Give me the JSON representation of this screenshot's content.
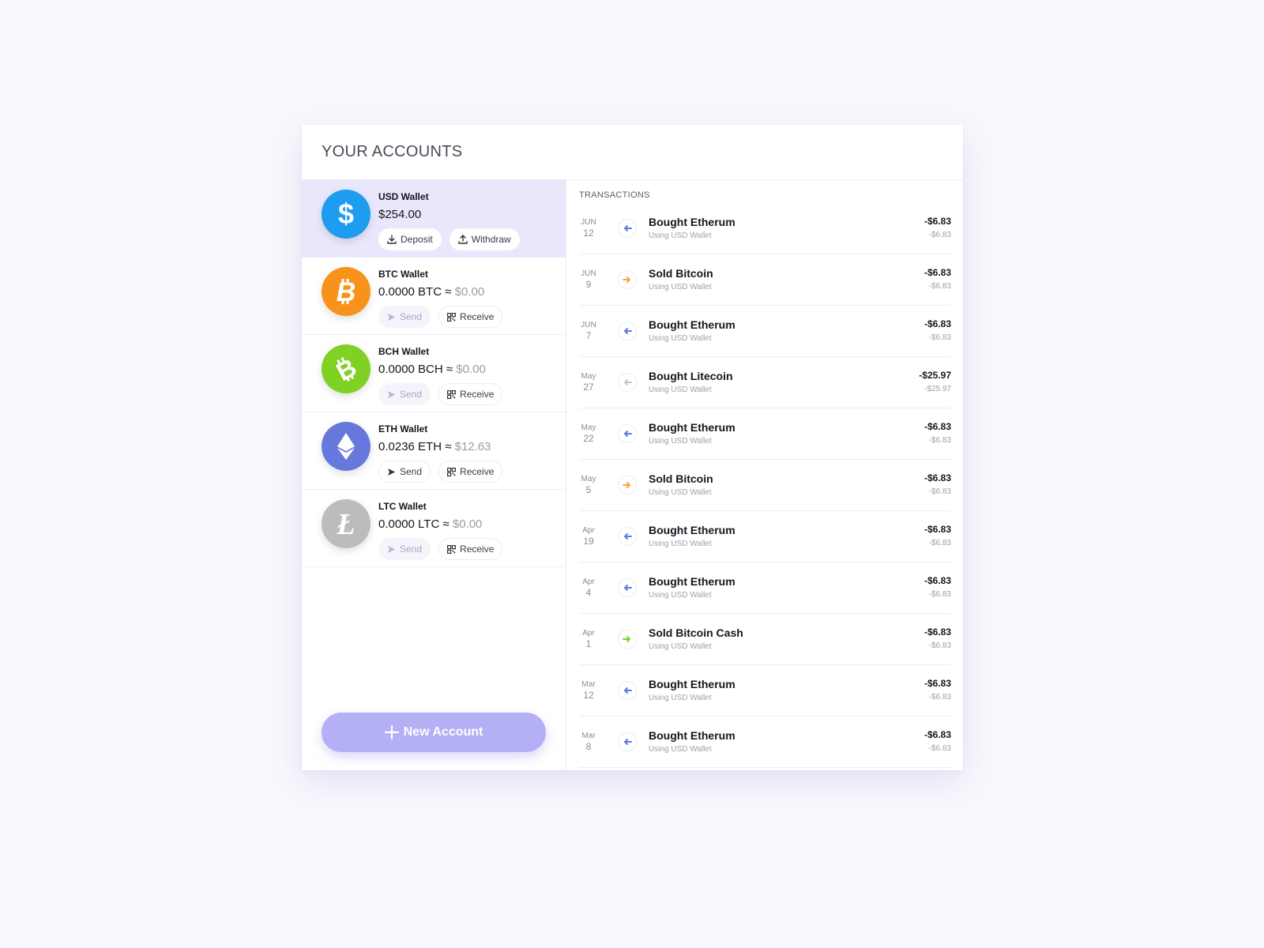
{
  "header": {
    "title": "YOUR ACCOUNTS"
  },
  "colors": {
    "accent": "#b4b0f5",
    "active_row": "#e8e7fb",
    "usd": "#1e9cf0",
    "btc": "#f7931a",
    "bch": "#7fd124",
    "eth": "#6778dc",
    "ltc": "#bcbcbc",
    "arrow_eth": "#6778dc",
    "arrow_btc": "#f7a83a",
    "arrow_bch": "#7fd124",
    "arrow_ltc": "#c4c4cc"
  },
  "accounts": [
    {
      "name": "USD Wallet",
      "balance": "$254.00",
      "approx": "",
      "fiat": "",
      "icon": "dollar-icon",
      "actions": [
        {
          "label": "Deposit",
          "icon": "download-icon"
        },
        {
          "label": "Withdraw",
          "icon": "upload-icon"
        }
      ]
    },
    {
      "name": "BTC Wallet",
      "balance": "0.0000 BTC",
      "approx": " ≈ ",
      "fiat": "$0.00",
      "icon": "bitcoin-icon",
      "actions": [
        {
          "label": "Send",
          "icon": "send-icon"
        },
        {
          "label": "Receive",
          "icon": "qr-code-icon"
        }
      ]
    },
    {
      "name": "BCH Wallet",
      "balance": "0.0000 BCH",
      "approx": " ≈ ",
      "fiat": "$0.00",
      "icon": "bitcoin-cash-icon",
      "actions": [
        {
          "label": "Send",
          "icon": "send-icon"
        },
        {
          "label": "Receive",
          "icon": "qr-code-icon"
        }
      ]
    },
    {
      "name": "ETH Wallet",
      "balance": "0.0236 ETH",
      "approx": " ≈ ",
      "fiat": "$12.63",
      "icon": "ethereum-icon",
      "actions": [
        {
          "label": "Send",
          "icon": "send-icon"
        },
        {
          "label": "Receive",
          "icon": "qr-code-icon"
        }
      ]
    },
    {
      "name": "LTC Wallet",
      "balance": "0.0000 LTC",
      "approx": " ≈ ",
      "fiat": "$0.00",
      "icon": "litecoin-icon",
      "actions": [
        {
          "label": "Send",
          "icon": "send-icon"
        },
        {
          "label": "Receive",
          "icon": "qr-code-icon"
        }
      ]
    }
  ],
  "new_account": {
    "label": "New Account"
  },
  "transactions": {
    "title": "TRANSACTIONS",
    "items": [
      {
        "month": "JUN",
        "day": "12",
        "direction": "in",
        "coin": "eth",
        "title": "Bought Etherum",
        "subtitle": "Using USD Wallet",
        "amount": "-$6.83",
        "amount_sub": "-$6.83"
      },
      {
        "month": "JUN",
        "day": "9",
        "direction": "out",
        "coin": "btc",
        "title": "Sold Bitcoin",
        "subtitle": "Using USD Wallet",
        "amount": "-$6.83",
        "amount_sub": "-$6.83"
      },
      {
        "month": "JUN",
        "day": "7",
        "direction": "in",
        "coin": "eth",
        "title": "Bought Etherum",
        "subtitle": "Using USD Wallet",
        "amount": "-$6.83",
        "amount_sub": "-$6.83"
      },
      {
        "month": "May",
        "day": "27",
        "direction": "in",
        "coin": "ltc",
        "title": "Bought Litecoin",
        "subtitle": "Using USD Wallet",
        "amount": "-$25.97",
        "amount_sub": "-$25.97"
      },
      {
        "month": "May",
        "day": "22",
        "direction": "in",
        "coin": "eth",
        "title": "Bought Etherum",
        "subtitle": "Using USD Wallet",
        "amount": "-$6.83",
        "amount_sub": "-$6.83"
      },
      {
        "month": "May",
        "day": "5",
        "direction": "out",
        "coin": "btc",
        "title": "Sold Bitcoin",
        "subtitle": "Using USD Wallet",
        "amount": "-$6.83",
        "amount_sub": "-$6.83"
      },
      {
        "month": "Apr",
        "day": "19",
        "direction": "in",
        "coin": "eth",
        "title": "Bought Etherum",
        "subtitle": "Using USD Wallet",
        "amount": "-$6.83",
        "amount_sub": "-$6.83"
      },
      {
        "month": "Apr",
        "day": "4",
        "direction": "in",
        "coin": "eth",
        "title": "Bought Etherum",
        "subtitle": "Using USD Wallet",
        "amount": "-$6.83",
        "amount_sub": "-$6.83"
      },
      {
        "month": "Apr",
        "day": "1",
        "direction": "out",
        "coin": "bch",
        "title": "Sold Bitcoin Cash",
        "subtitle": "Using USD Wallet",
        "amount": "-$6.83",
        "amount_sub": "-$6.83"
      },
      {
        "month": "Mar",
        "day": "12",
        "direction": "in",
        "coin": "eth",
        "title": "Bought Etherum",
        "subtitle": "Using USD Wallet",
        "amount": "-$6.83",
        "amount_sub": "-$6.83"
      },
      {
        "month": "Mar",
        "day": "8",
        "direction": "in",
        "coin": "eth",
        "title": "Bought Etherum",
        "subtitle": "Using USD Wallet",
        "amount": "-$6.83",
        "amount_sub": "-$6.83"
      }
    ]
  }
}
